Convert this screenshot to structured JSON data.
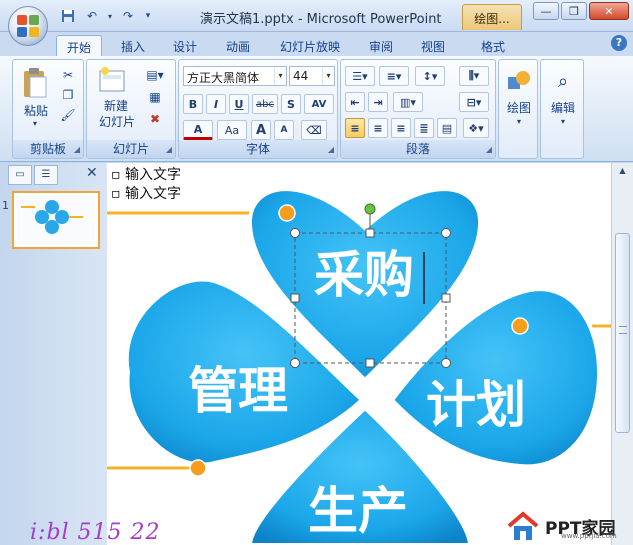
{
  "window": {
    "title": "演示文稿1.pptx - Microsoft PowerPoint",
    "context_tab_group": "绘图..."
  },
  "tabs": [
    {
      "label": "开始",
      "active": true
    },
    {
      "label": "插入"
    },
    {
      "label": "设计"
    },
    {
      "label": "动画"
    },
    {
      "label": "幻灯片放映"
    },
    {
      "label": "审阅"
    },
    {
      "label": "视图"
    },
    {
      "label": "格式"
    }
  ],
  "ribbon": {
    "clipboard": {
      "label": "剪贴板",
      "paste": "粘贴"
    },
    "slides": {
      "label": "幻灯片",
      "new_slide_line1": "新建",
      "new_slide_line2": "幻灯片"
    },
    "font": {
      "label": "字体",
      "font_name": "方正大黑简体",
      "font_size": "44",
      "bold": "B",
      "italic": "I",
      "underline": "U",
      "strike": "abc",
      "shadow": "S",
      "spacing": "AV",
      "color": "A",
      "case": "Aa",
      "grow": "A",
      "shrink": "A"
    },
    "paragraph": {
      "label": "段落"
    },
    "drawing": {
      "label": "绘图"
    },
    "editing": {
      "label": "编辑"
    }
  },
  "slide": {
    "bullets": [
      "输入文字",
      "输入文字"
    ],
    "petals": [
      {
        "text": "采购",
        "color": "#1da8ea"
      },
      {
        "text": "管理",
        "color": "#1da8ea"
      },
      {
        "text": "计划",
        "color": "#1da8ea"
      },
      {
        "text": "生产",
        "color": "#1da8ea"
      }
    ],
    "connector_color": "#f5b324",
    "dot_color": "#f59d1c"
  },
  "slide_panel": {
    "slide_number": "1"
  },
  "watermark": {
    "brand": "PPT家园",
    "url": "www.pptjia.com"
  },
  "handwriting": "i:bl 515 22"
}
